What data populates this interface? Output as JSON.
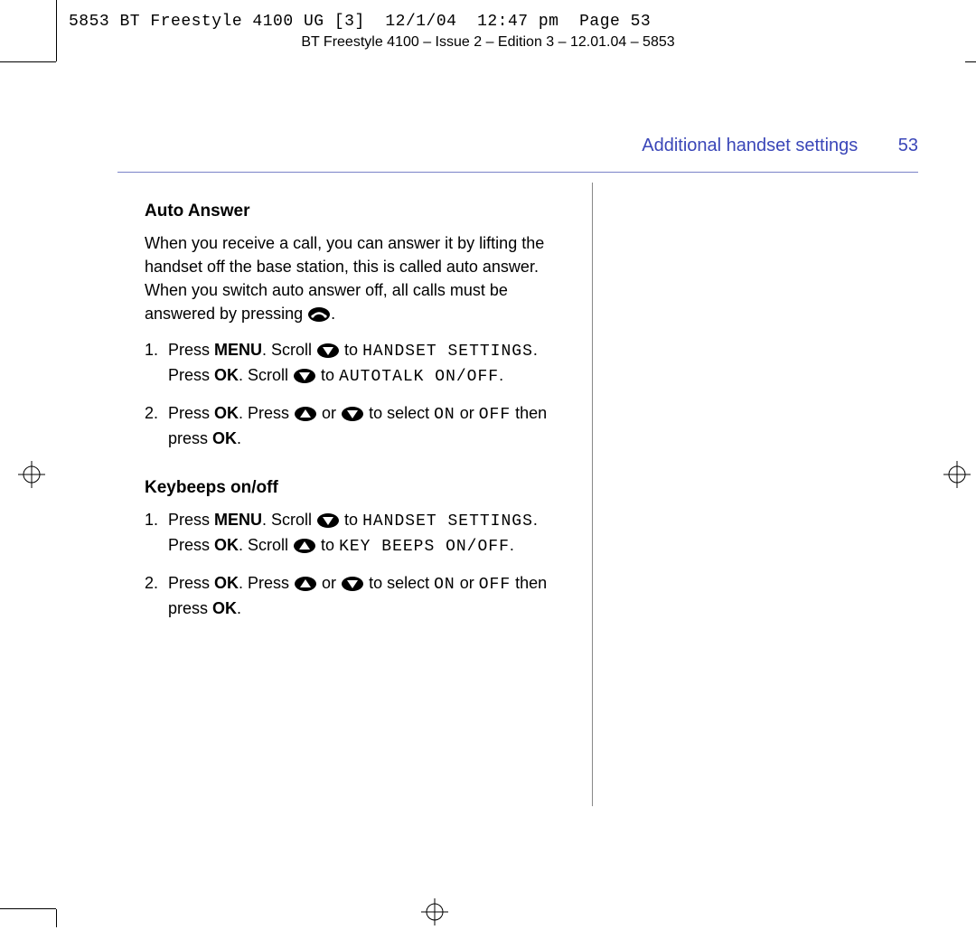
{
  "slug": "5853 BT Freestyle 4100 UG [3]  12/1/04  12:47 pm  Page 53",
  "footer": "BT Freestyle 4100 – Issue 2 – Edition 3 – 12.01.04 – 5853",
  "header": {
    "section": "Additional handset settings",
    "page": "53"
  },
  "sections": {
    "auto_answer": {
      "title": "Auto Answer",
      "intro_pre": "When you receive a call, you can answer it by lifting the handset off the base station, this is called auto answer. When you switch auto answer off, all calls must be answered by pressing ",
      "intro_post": ".",
      "step1": {
        "num": "1.",
        "t1": "Press ",
        "menu": "MENU",
        "t2": ". Scroll ",
        "t3": " to ",
        "lcd1": "HANDSET SETTINGS",
        "t4": ".",
        "t5": "Press ",
        "ok1": "OK",
        "t6": ". Scroll ",
        "t7": " to ",
        "lcd2": "AUTOTALK ON/OFF",
        "t8": "."
      },
      "step2": {
        "num": "2.",
        "t1": "Press ",
        "ok1": "OK",
        "t2": ". Press ",
        "t3": " or ",
        "t4": " to select ",
        "lcd_on": "ON",
        "t5": " or ",
        "lcd_off": "OFF",
        "t6": " then press ",
        "ok2": "OK",
        "t7": "."
      }
    },
    "keybeeps": {
      "title": "Keybeeps on/off",
      "step1": {
        "num": "1.",
        "t1": "Press ",
        "menu": "MENU",
        "t2": ". Scroll ",
        "t3": " to ",
        "lcd1": "HANDSET SETTINGS",
        "t4": ".",
        "t5": "Press ",
        "ok1": "OK",
        "t6": ". Scroll ",
        "t7": " to ",
        "lcd2": "KEY BEEPS ON/OFF",
        "t8": "."
      },
      "step2": {
        "num": "2.",
        "t1": "Press ",
        "ok1": "OK",
        "t2": ". Press ",
        "t3": " or ",
        "t4": " to select ",
        "lcd_on": "ON",
        "t5": " or ",
        "lcd_off": "OFF",
        "t6": " then press ",
        "ok2": "OK",
        "t7": "."
      }
    }
  }
}
